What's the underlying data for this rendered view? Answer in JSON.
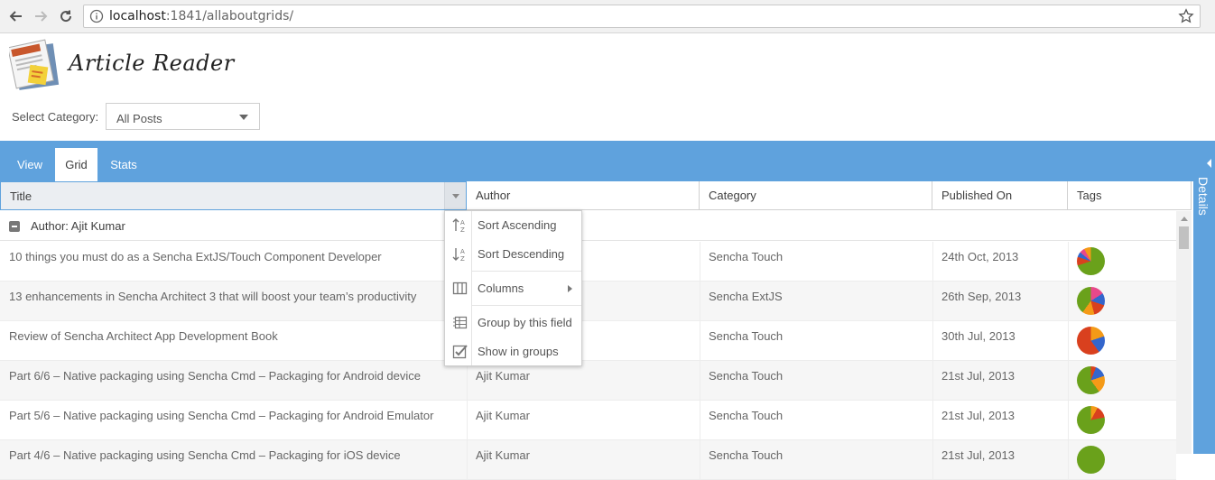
{
  "browser": {
    "url_host": "localhost",
    "url_rest": ":1841/allaboutgrids/"
  },
  "app": {
    "title": "Article Reader",
    "category_label": "Select Category:",
    "category_value": "All Posts"
  },
  "tabs": [
    {
      "label": "View"
    },
    {
      "label": "Grid"
    },
    {
      "label": "Stats"
    }
  ],
  "active_tab": "Grid",
  "side_panel_label": "Details",
  "grid": {
    "columns": [
      "Title",
      "Author",
      "Category",
      "Published On",
      "Tags"
    ],
    "group_label": "Author: Ajit Kumar",
    "rows": [
      {
        "title": "10 things you must do as a Sencha ExtJS/Touch Component Developer",
        "author": "",
        "category": "Sencha Touch",
        "published": "24th Oct, 2013"
      },
      {
        "title": "13 enhancements in Sencha Architect 3 that will boost your team’s productivity",
        "author": "",
        "category": "Sencha ExtJS",
        "published": "26th Sep, 2013"
      },
      {
        "title": "Review of Sencha Architect App Development Book",
        "author": "",
        "category": "Sencha Touch",
        "published": "30th Jul, 2013"
      },
      {
        "title": "Part 6/6 – Native packaging using Sencha Cmd – Packaging for Android device",
        "author": "Ajit Kumar",
        "category": "Sencha Touch",
        "published": "21st Jul, 2013"
      },
      {
        "title": "Part 5/6 – Native packaging using Sencha Cmd – Packaging for Android Emulator",
        "author": "Ajit Kumar",
        "category": "Sencha Touch",
        "published": "21st Jul, 2013"
      },
      {
        "title": "Part 4/6 – Native packaging using Sencha Cmd – Packaging for iOS device",
        "author": "Ajit Kumar",
        "category": "Sencha Touch",
        "published": "21st Jul, 2013"
      }
    ]
  },
  "column_menu": {
    "items": [
      {
        "label": "Sort Ascending",
        "icon": "sort-ascending-icon"
      },
      {
        "label": "Sort Descending",
        "icon": "sort-descending-icon"
      },
      {
        "label": "Columns",
        "icon": "columns-icon"
      },
      {
        "label": "Group by this field",
        "icon": "group-by-icon"
      },
      {
        "label": "Show in groups",
        "icon": "checkbox-checked-icon"
      }
    ]
  },
  "colors": {
    "accent": "#5fa2dd",
    "pie_green": "#6aa11b",
    "pie_red": "#d9401e",
    "pie_orange": "#f49a17",
    "pie_blue": "#3366cc",
    "pie_pink": "#e8488a"
  }
}
